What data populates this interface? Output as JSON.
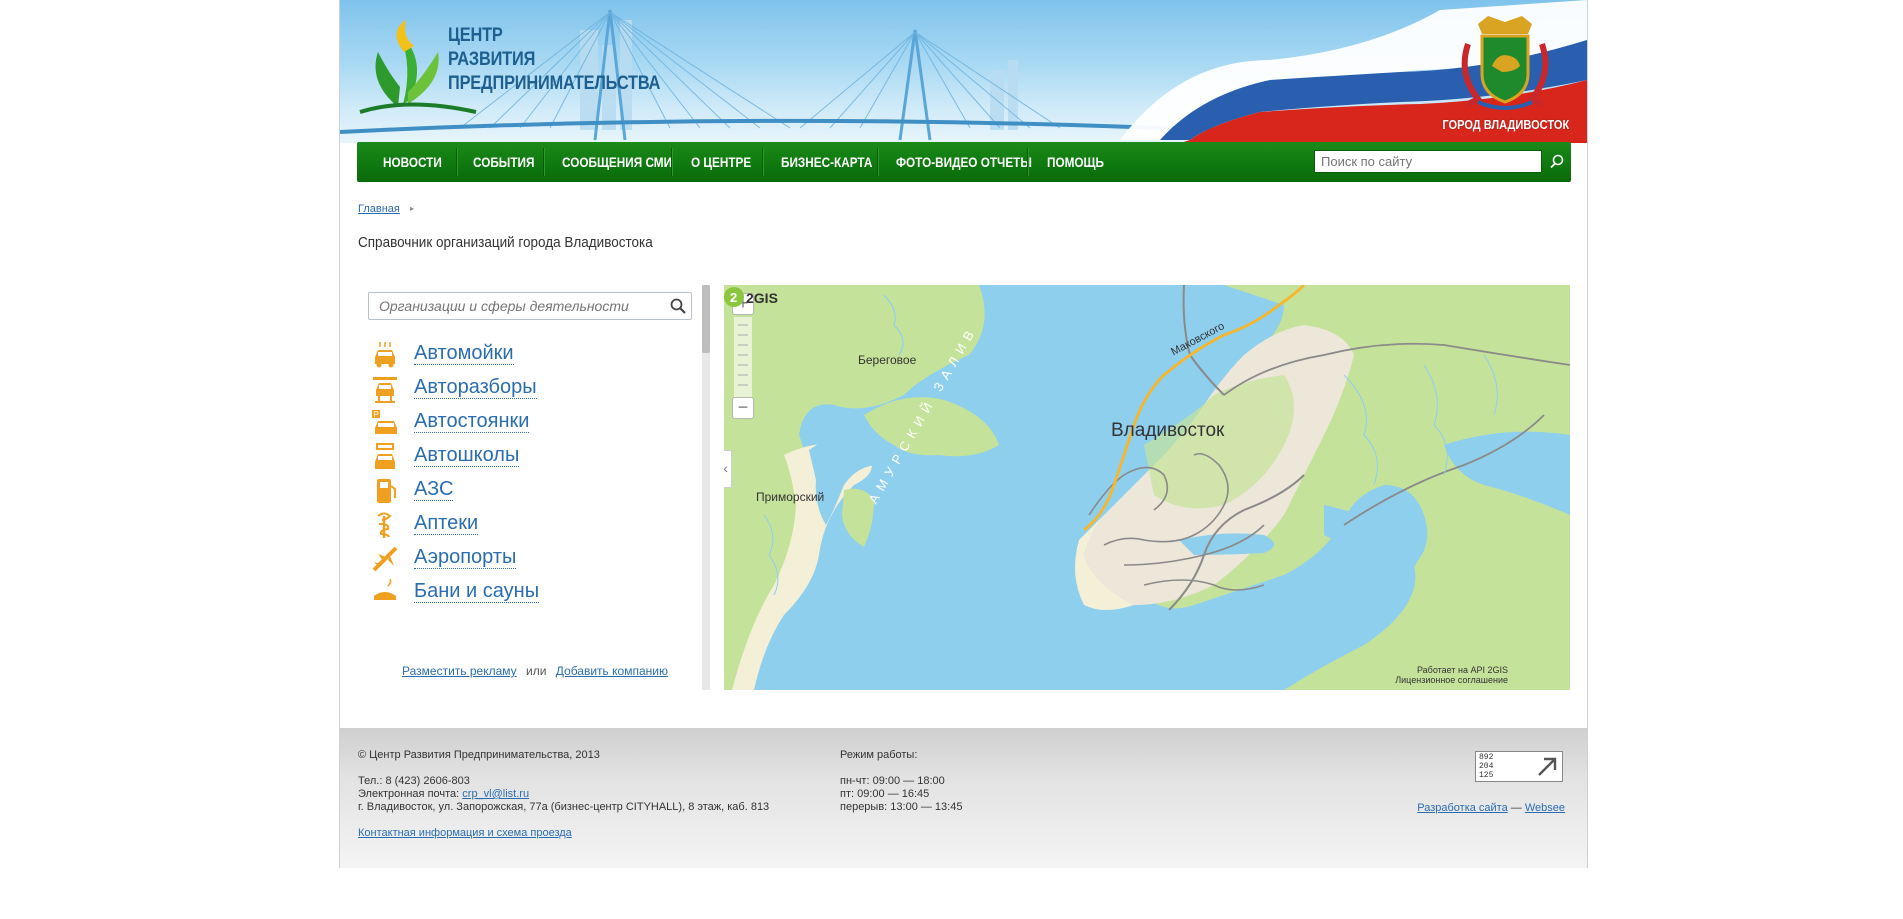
{
  "header": {
    "logo_lines": [
      "ЦЕНТР",
      "РАЗВИТИЯ",
      "ПРЕДПРИНИМАТЕЛЬСТВА"
    ],
    "city_label": "ГОРОД ВЛАДИВОСТОК"
  },
  "nav": {
    "items": [
      "НОВОСТИ",
      "СОБЫТИЯ",
      "СООБЩЕНИЯ СМИ",
      "О ЦЕНТРЕ",
      "БИЗНЕС-КАРТА",
      "ФОТО-ВИДЕО ОТЧЕТЫ",
      "ПОМОЩЬ"
    ],
    "search_placeholder": "Поиск по сайту"
  },
  "breadcrumb": {
    "home": "Главная"
  },
  "page_title": "Справочник организаций города Владивостока",
  "catalog": {
    "search_placeholder": "Организации и сферы деятельности",
    "items": [
      {
        "label": "Автомойки",
        "icon": "car-wash-icon"
      },
      {
        "label": "Авторазборы",
        "icon": "car-lift-icon"
      },
      {
        "label": "Автостоянки",
        "icon": "parking-icon"
      },
      {
        "label": "Автошколы",
        "icon": "driving-school-icon"
      },
      {
        "label": "АЗС",
        "icon": "fuel-pump-icon"
      },
      {
        "label": "Аптеки",
        "icon": "pharmacy-icon"
      },
      {
        "label": "Аэропорты",
        "icon": "airplane-icon"
      },
      {
        "label": "Бани и сауны",
        "icon": "sauna-icon"
      }
    ],
    "advertise_link": "Разместить рекламу",
    "or_text": "или",
    "add_company_link": "Добавить компанию"
  },
  "map": {
    "labels": {
      "beregovoe": "Береговое",
      "primorsky": "Приморский",
      "amur_bay": "АМУРСКИЙ ЗАЛИВ",
      "city": "Владивосток",
      "makovskogo": "Маковского"
    },
    "attribution_line1": "Работает на API 2GIS",
    "attribution_line2": "Лицензионное соглашение",
    "brand": "2GIS",
    "collapse_symbol": "«",
    "zoom_in": "+",
    "zoom_out": "−",
    "colors": {
      "water": "#8fcfee",
      "land": "#c5e29a",
      "beach": "#f4efd7",
      "urban": "#ece7d8"
    }
  },
  "footer": {
    "copyright": "© Центр Развития Предпринимательства, 2013",
    "phone": "Тел.: 8 (423) 2606-803",
    "email_label": "Электронная почта:",
    "email": "crp_vl@list.ru",
    "address": "г. Владивосток, ул. Запорожская, 77а (бизнес-центр CITYHALL), 8 этаж, каб. 813",
    "contacts_link": "Контактная информация и схема проезда",
    "hours_title": "Режим работы:",
    "hours": [
      "пн-чт: 09:00 — 18:00",
      "пт: 09:00 — 16:45",
      "перерыв: 13:00 — 13:45"
    ],
    "dev_link": "Разработка сайта",
    "dev_dash": "—",
    "dev_company": "Websee",
    "counter_lines": [
      "892",
      "204",
      "125"
    ]
  },
  "colors": {
    "nav_green": "#107b10",
    "link_blue": "#2a6db0",
    "title_blue": "#1d5f8f",
    "icon_orange": "#f0a020"
  }
}
